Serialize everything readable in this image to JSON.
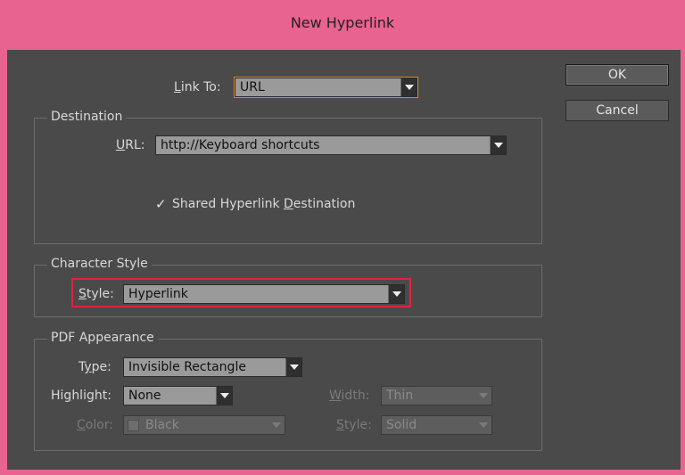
{
  "window": {
    "title": "New Hyperlink"
  },
  "link_to": {
    "label_accel": "L",
    "label_rest": "ink To:",
    "value": "URL"
  },
  "buttons": {
    "ok": "OK",
    "cancel": "Cancel"
  },
  "destination": {
    "group_title": "Destination",
    "url_label_accel": "U",
    "url_label_rest": "RL:",
    "url_value": "http://Keyboard shortcuts",
    "shared_check_pre": "Shared Hyperlink ",
    "shared_check_accel": "D",
    "shared_check_post": "estination",
    "shared_checked": true
  },
  "character_style": {
    "group_title": "Character Style",
    "style_label_accel": "S",
    "style_label_rest": "tyle:",
    "style_value": "Hyperlink"
  },
  "pdf_appearance": {
    "group_title": "PDF Appearance",
    "type_label_pre": "T",
    "type_label_accel": "y",
    "type_label_post": "pe:",
    "type_value": "Invisible Rectangle",
    "highlight_label_pre": "Hi",
    "highlight_label_accel": "g",
    "highlight_label_post": "hlight:",
    "highlight_value": "None",
    "width_label_accel": "W",
    "width_label_rest": "idth:",
    "width_value": "Thin",
    "color_label_accel": "C",
    "color_label_rest": "olor:",
    "color_value": "Black",
    "style_label_accel": "S",
    "style_label_rest": "tyle:",
    "style_value": "Solid"
  },
  "colors": {
    "title_bar": "#e8638f",
    "panel": "#4a4a4a",
    "highlight_box": "#e0233a",
    "focus_outline": "#d98a2a"
  }
}
